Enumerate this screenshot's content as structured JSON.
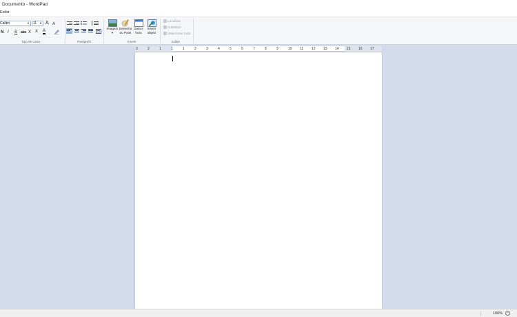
{
  "window": {
    "title": "Documento - WordPad"
  },
  "menu": {
    "tab": "Exibir"
  },
  "ribbon": {
    "font": {
      "family": "Calibri",
      "size": "11",
      "grow": "A",
      "shrink": "A",
      "bold": "N",
      "italic": "I",
      "underline": "S",
      "strike": "abc",
      "subscript": "X",
      "superscript": "X",
      "color_glyph": "A",
      "group_label": "Tipo de Letra"
    },
    "paragraph": {
      "group_label": "Parágrafo"
    },
    "insert": {
      "items": [
        {
          "label1": "Imagem",
          "label2": "▾"
        },
        {
          "label1": "Desenho",
          "label2": "do Paint"
        },
        {
          "label1": "Data e",
          "label2": "hora"
        },
        {
          "label1": "Inserir",
          "label2": "objeto"
        }
      ],
      "group_label": "Inserir"
    },
    "edit": {
      "find": "Localizar",
      "replace": "Substituir",
      "select_all": "Selecionar tudo",
      "group_label": "Editar"
    }
  },
  "ruler": {
    "labels": [
      "3",
      "2",
      "1",
      "1",
      "1",
      "2",
      "3",
      "4",
      "5",
      "6",
      "7",
      "8",
      "9",
      "10",
      "11",
      "12",
      "13",
      "14",
      "15",
      "16",
      "17"
    ]
  },
  "status": {
    "zoom": "100%",
    "zoom_out": "−"
  }
}
